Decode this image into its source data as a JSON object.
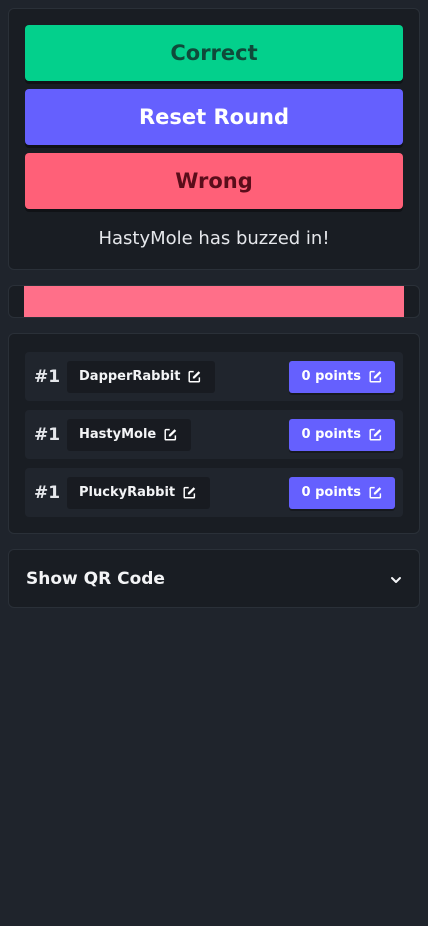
{
  "controls": {
    "correct_label": "Correct",
    "reset_label": "Reset Round",
    "wrong_label": "Wrong",
    "buzz_message": "HastyMole has buzzed in!",
    "colors": {
      "correct": "#03d08c",
      "reset": "#6560fe",
      "wrong": "#ff6078"
    }
  },
  "timer": {
    "progress": 1.0,
    "color": "#ff6f89"
  },
  "players": [
    {
      "rank": "#1",
      "name": "DapperRabbit",
      "points": "0 points"
    },
    {
      "rank": "#1",
      "name": "HastyMole",
      "points": "0 points"
    },
    {
      "rank": "#1",
      "name": "PluckyRabbit",
      "points": "0 points"
    }
  ],
  "qr": {
    "label": "Show QR Code",
    "icon": "chevron-down-icon"
  },
  "icons": {
    "edit": "edit-icon"
  }
}
